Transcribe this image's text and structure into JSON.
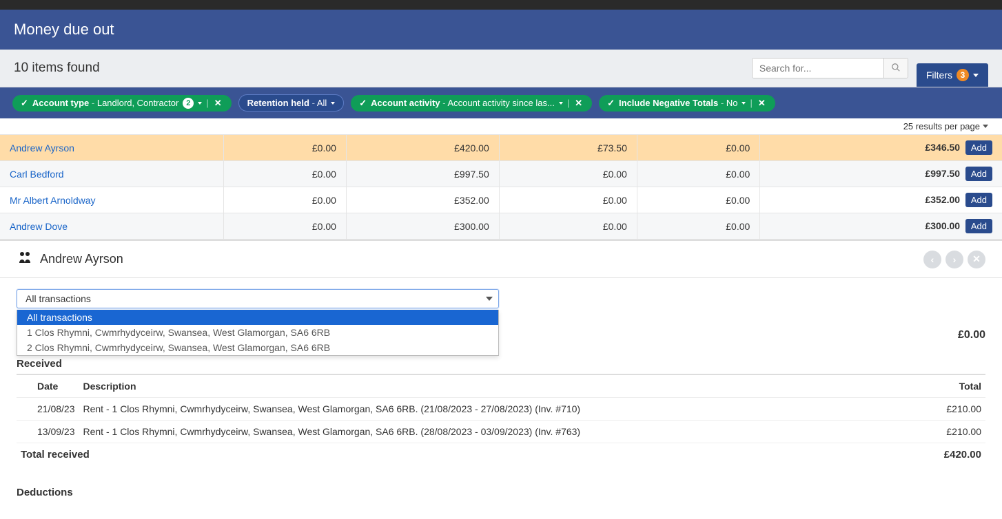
{
  "header": {
    "title": "Money due out"
  },
  "subheader": {
    "items_found": "10 items found",
    "search_placeholder": "Search for...",
    "filters_label": "Filters",
    "filters_count": "3"
  },
  "filters": {
    "account_type": {
      "label": "Account type",
      "value": "Landlord, Contractor",
      "count": "2"
    },
    "retention": {
      "label": "Retention held",
      "value": "All"
    },
    "activity": {
      "label": "Account activity",
      "value": "Account activity since las..."
    },
    "negative": {
      "label": "Include Negative Totals",
      "value": "No"
    }
  },
  "pager": {
    "text": "25 results per page"
  },
  "rows": [
    {
      "name": "Andrew Ayrson",
      "c1": "£0.00",
      "c2": "£420.00",
      "c3": "£73.50",
      "c4": "£0.00",
      "c5": "£346.50",
      "selected": true
    },
    {
      "name": "Carl Bedford",
      "c1": "£0.00",
      "c2": "£997.50",
      "c3": "£0.00",
      "c4": "£0.00",
      "c5": "£997.50",
      "alt": true
    },
    {
      "name": "Mr Albert Arnoldway",
      "c1": "£0.00",
      "c2": "£352.00",
      "c3": "£0.00",
      "c4": "£0.00",
      "c5": "£352.00"
    },
    {
      "name": "Andrew Dove",
      "c1": "£0.00",
      "c2": "£300.00",
      "c3": "£0.00",
      "c4": "£0.00",
      "c5": "£300.00",
      "alt": true
    }
  ],
  "add_label": "Add",
  "detail": {
    "person_name": "Andrew Ayrson",
    "dropdown": {
      "selected": "All transactions",
      "options": [
        "All transactions",
        "1 Clos Rhymni, Cwmrhydyceirw, Swansea, West Glamorgan, SA6 6RB",
        "2 Clos Rhymni, Cwmrhydyceirw, Swansea, West Glamorgan, SA6 6RB"
      ]
    },
    "balance_value": "£0.00",
    "received_label": "Received",
    "columns": {
      "date": "Date",
      "description": "Description",
      "total": "Total"
    },
    "received_rows": [
      {
        "date": "21/08/23",
        "desc": "Rent - 1 Clos Rhymni, Cwmrhydyceirw, Swansea, West Glamorgan, SA6 6RB. (21/08/2023 - 27/08/2023) (Inv. #710)",
        "total": "£210.00"
      },
      {
        "date": "13/09/23",
        "desc": "Rent - 1 Clos Rhymni, Cwmrhydyceirw, Swansea, West Glamorgan, SA6 6RB. (28/08/2023 - 03/09/2023) (Inv. #763)",
        "total": "£210.00"
      }
    ],
    "total_received_label": "Total received",
    "total_received_value": "£420.00",
    "deductions_label": "Deductions"
  }
}
